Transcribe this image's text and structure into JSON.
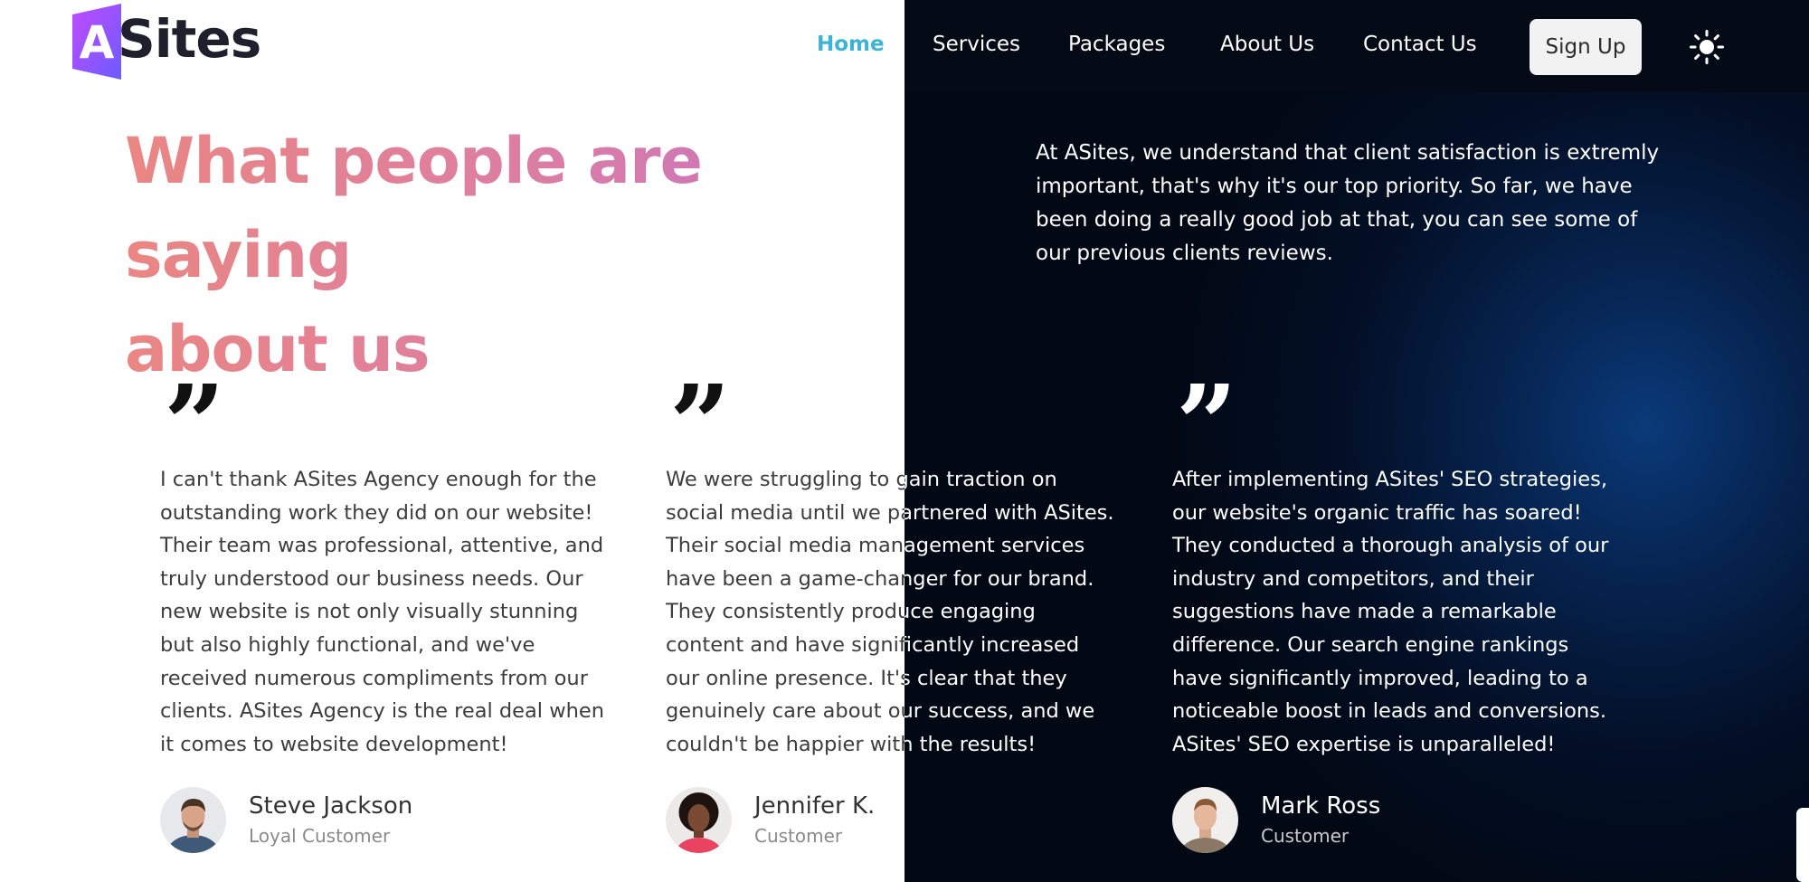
{
  "brand": {
    "name": "ASites",
    "logo_letter": "A"
  },
  "nav": {
    "items": [
      "Home",
      "Services",
      "Packages",
      "About Us",
      "Contact Us"
    ],
    "active": "Home",
    "signup_label": "Sign Up"
  },
  "colors": {
    "accent": "#3cb4d6",
    "heading_gradient": [
      "#ea8683",
      "#dc7ea3",
      "#c271c9"
    ],
    "dark_bg": "#030f26"
  },
  "section": {
    "heading_line1": "What people are saying",
    "heading_line2": "about us",
    "intro": "At ASites, we understand that client satisfaction is extremly important, that's why it's our top priority. So far, we have been doing a really good job at that, you can see some of our previous clients reviews."
  },
  "testimonials": [
    {
      "quote": "I can't thank ASites Agency enough for the\noutstanding work they did on our website!\nTheir team was professional, attentive, and\ntruly understood our business needs. Our\nnew website is not only visually stunning\nbut also highly functional, and we've\nreceived numerous compliments from our\nclients. ASites Agency is the real deal when\nit comes to website development!",
      "name": "Steve Jackson",
      "role": "Loyal Customer"
    },
    {
      "quote": "We were struggling to gain traction on\nsocial media until we partnered with ASites.\nTheir social media management services\nhave been a game-changer for our brand.\nThey consistently produce engaging\ncontent and have significantly increased\nour online presence. It's clear that they\ngenuinely care about our success, and we\ncouldn't be happier with the results!",
      "name": "Jennifer K.",
      "role": "Customer"
    },
    {
      "quote": "After implementing ASites' SEO strategies,\nour website's organic traffic has soared!\nThey conducted a thorough analysis of our\nindustry and competitors, and their\nsuggestions have made a remarkable\ndifference. Our search engine rankings\nhave significantly improved, leading to a\nnoticeable boost in leads and conversions.\nASites' SEO expertise is unparalleled!",
      "name": "Mark Ross",
      "role": "Customer"
    }
  ],
  "quote_glyph": "”",
  "icons": {
    "theme_toggle": "sun-icon",
    "quote": "quote-icon",
    "avatar": "avatar"
  }
}
